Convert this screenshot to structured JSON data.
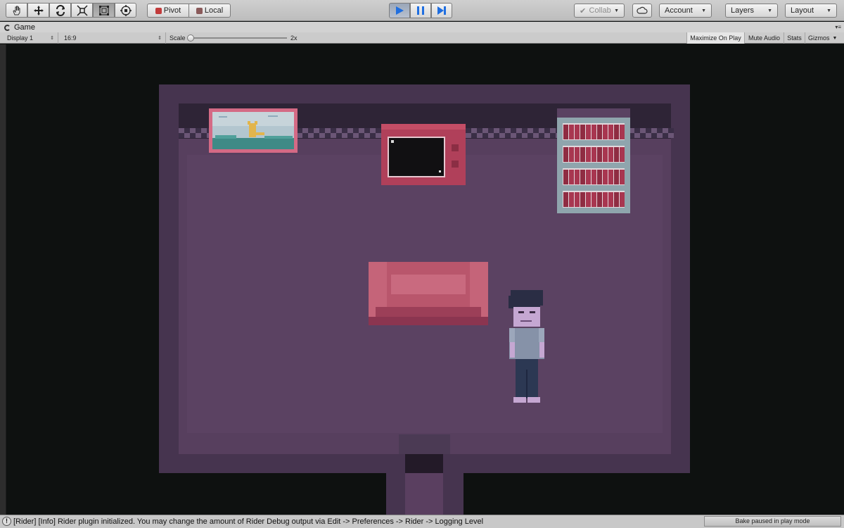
{
  "toolbar": {
    "tools": [
      {
        "name": "hand-tool",
        "icon": "hand-icon"
      },
      {
        "name": "move-tool",
        "icon": "move-arrows-icon"
      },
      {
        "name": "rotate-tool",
        "icon": "rotate-icon"
      },
      {
        "name": "scale-tool",
        "icon": "scale-icon"
      },
      {
        "name": "rect-tool",
        "icon": "rect-tool-icon"
      },
      {
        "name": "transform-tool",
        "icon": "transform-icon"
      }
    ],
    "pivot_label": "Pivot",
    "local_label": "Local",
    "playback": {
      "play_icon": "play-icon",
      "pause_icon": "pause-icon",
      "step_icon": "step-icon",
      "play_color": "#1f6ee0"
    },
    "collab_label": "Collab",
    "cloud_icon": "cloud-icon",
    "account_label": "Account",
    "layers_label": "Layers",
    "layout_label": "Layout"
  },
  "game_tab": {
    "title": "Game",
    "icon": "game-view-icon"
  },
  "game_controls": {
    "display": "Display 1",
    "aspect": "16:9",
    "scale_label": "Scale",
    "scale_value": "2x",
    "maximize_label": "Maximize On Play",
    "mute_label": "Mute Audio",
    "stats_label": "Stats",
    "gizmos_label": "Gizmos"
  },
  "scene": {
    "colors": {
      "background": "#0e1110",
      "outer_wall": "#46344f",
      "inner_wall": "#2e2436",
      "floor": "#573f5e",
      "accent": "#c44d66"
    }
  },
  "status": {
    "message": "[Rider] [Info] Rider plugin initialized. You may change the amount of Rider Debug output via Edit -> Preferences -> Rider -> Logging Level",
    "bake": "Bake paused in play mode"
  }
}
